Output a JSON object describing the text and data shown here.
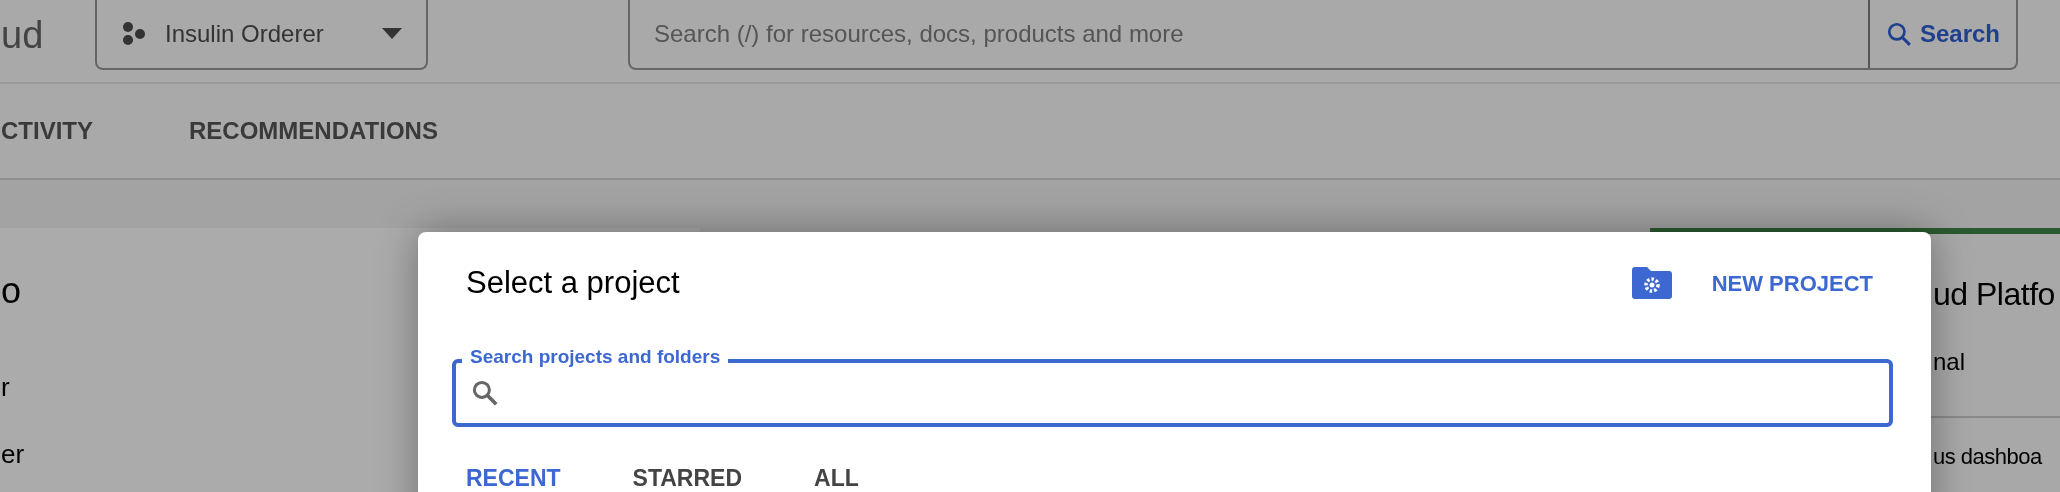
{
  "header": {
    "logo_text": "ud",
    "project_picker": {
      "label": "Insulin Orderer"
    },
    "search": {
      "placeholder": "Search (/) for resources, docs, products and more",
      "button": "Search"
    }
  },
  "nav_tabs": [
    {
      "label": "CTIVITY"
    },
    {
      "label": "RECOMMENDATIONS"
    }
  ],
  "background": {
    "left": [
      "o",
      "r",
      "er"
    ],
    "right": {
      "title": "ud Platfo",
      "line_1": "nal",
      "line_2": "us dashboa"
    }
  },
  "dialog": {
    "title": "Select a project",
    "new_project": "NEW PROJECT",
    "search": {
      "label": "Search projects and folders"
    },
    "tabs": [
      {
        "label": "RECENT",
        "selected": true
      },
      {
        "label": "STARRED",
        "selected": false
      },
      {
        "label": "ALL",
        "selected": false
      }
    ]
  }
}
